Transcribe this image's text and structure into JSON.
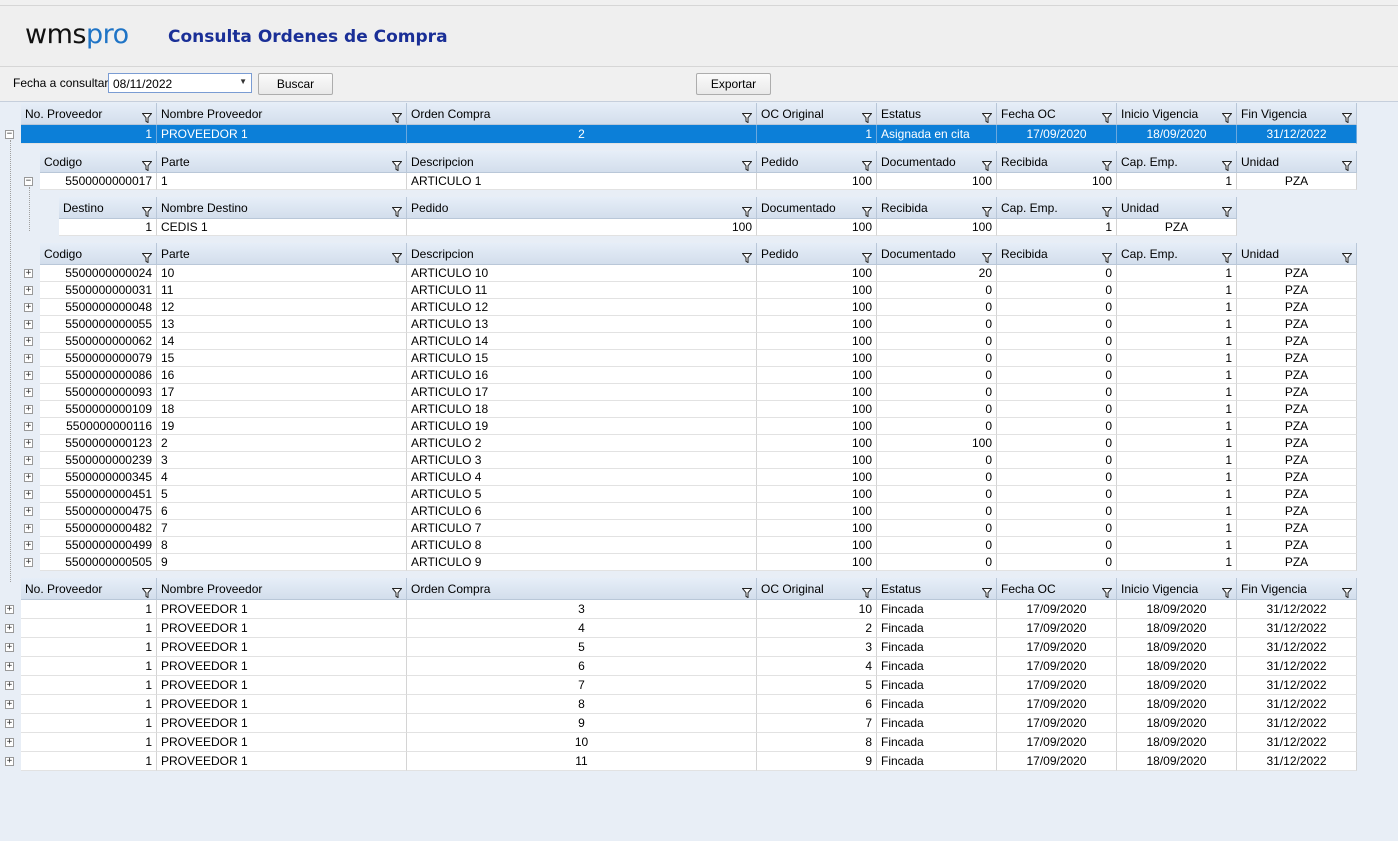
{
  "app": {
    "logo_wms": "wms",
    "logo_pro": "pro",
    "title": "Consulta Ordenes de Compra"
  },
  "toolbar": {
    "fecha_label": "Fecha a consultar",
    "fecha_value": "08/11/2022",
    "buscar": "Buscar",
    "exportar": "Exportar"
  },
  "oc_headers": [
    "No. Proveedor",
    "Nombre Proveedor",
    "Orden Compra",
    "OC Original",
    "Estatus",
    "Fecha OC",
    "Inicio Vigencia",
    "Fin Vigencia"
  ],
  "selected_order": [
    "1",
    "PROVEEDOR 1",
    "2",
    "1",
    "Asignada en cita",
    "17/09/2020",
    "18/09/2020",
    "31/12/2022"
  ],
  "item_headers": [
    "Codigo",
    "Parte",
    "Descripcion",
    "Pedido",
    "Documentado",
    "Recibida",
    "Cap. Emp.",
    "Unidad"
  ],
  "expanded_item": [
    "5500000000017",
    "1",
    "ARTICULO 1",
    "100",
    "100",
    "100",
    "1",
    "PZA"
  ],
  "dest_headers": [
    "Destino",
    "Nombre Destino",
    "Pedido",
    "Documentado",
    "Recibida",
    "Cap. Emp.",
    "Unidad"
  ],
  "dest_row": [
    "1",
    "CEDIS 1",
    "100",
    "100",
    "100",
    "1",
    "PZA"
  ],
  "items": [
    [
      "5500000000024",
      "10",
      "ARTICULO 10",
      "100",
      "20",
      "0",
      "1",
      "PZA"
    ],
    [
      "5500000000031",
      "11",
      "ARTICULO 11",
      "100",
      "0",
      "0",
      "1",
      "PZA"
    ],
    [
      "5500000000048",
      "12",
      "ARTICULO 12",
      "100",
      "0",
      "0",
      "1",
      "PZA"
    ],
    [
      "5500000000055",
      "13",
      "ARTICULO 13",
      "100",
      "0",
      "0",
      "1",
      "PZA"
    ],
    [
      "5500000000062",
      "14",
      "ARTICULO 14",
      "100",
      "0",
      "0",
      "1",
      "PZA"
    ],
    [
      "5500000000079",
      "15",
      "ARTICULO 15",
      "100",
      "0",
      "0",
      "1",
      "PZA"
    ],
    [
      "5500000000086",
      "16",
      "ARTICULO 16",
      "100",
      "0",
      "0",
      "1",
      "PZA"
    ],
    [
      "5500000000093",
      "17",
      "ARTICULO 17",
      "100",
      "0",
      "0",
      "1",
      "PZA"
    ],
    [
      "5500000000109",
      "18",
      "ARTICULO 18",
      "100",
      "0",
      "0",
      "1",
      "PZA"
    ],
    [
      "5500000000116",
      "19",
      "ARTICULO 19",
      "100",
      "0",
      "0",
      "1",
      "PZA"
    ],
    [
      "5500000000123",
      "2",
      "ARTICULO 2",
      "100",
      "100",
      "0",
      "1",
      "PZA"
    ],
    [
      "5500000000239",
      "3",
      "ARTICULO 3",
      "100",
      "0",
      "0",
      "1",
      "PZA"
    ],
    [
      "5500000000345",
      "4",
      "ARTICULO 4",
      "100",
      "0",
      "0",
      "1",
      "PZA"
    ],
    [
      "5500000000451",
      "5",
      "ARTICULO 5",
      "100",
      "0",
      "0",
      "1",
      "PZA"
    ],
    [
      "5500000000475",
      "6",
      "ARTICULO 6",
      "100",
      "0",
      "0",
      "1",
      "PZA"
    ],
    [
      "5500000000482",
      "7",
      "ARTICULO 7",
      "100",
      "0",
      "0",
      "1",
      "PZA"
    ],
    [
      "5500000000499",
      "8",
      "ARTICULO 8",
      "100",
      "0",
      "0",
      "1",
      "PZA"
    ],
    [
      "5500000000505",
      "9",
      "ARTICULO 9",
      "100",
      "0",
      "0",
      "1",
      "PZA"
    ]
  ],
  "orders": [
    [
      "1",
      "PROVEEDOR 1",
      "3",
      "10",
      "Fincada",
      "17/09/2020",
      "18/09/2020",
      "31/12/2022"
    ],
    [
      "1",
      "PROVEEDOR 1",
      "4",
      "2",
      "Fincada",
      "17/09/2020",
      "18/09/2020",
      "31/12/2022"
    ],
    [
      "1",
      "PROVEEDOR 1",
      "5",
      "3",
      "Fincada",
      "17/09/2020",
      "18/09/2020",
      "31/12/2022"
    ],
    [
      "1",
      "PROVEEDOR 1",
      "6",
      "4",
      "Fincada",
      "17/09/2020",
      "18/09/2020",
      "31/12/2022"
    ],
    [
      "1",
      "PROVEEDOR 1",
      "7",
      "5",
      "Fincada",
      "17/09/2020",
      "18/09/2020",
      "31/12/2022"
    ],
    [
      "1",
      "PROVEEDOR 1",
      "8",
      "6",
      "Fincada",
      "17/09/2020",
      "18/09/2020",
      "31/12/2022"
    ],
    [
      "1",
      "PROVEEDOR 1",
      "9",
      "7",
      "Fincada",
      "17/09/2020",
      "18/09/2020",
      "31/12/2022"
    ],
    [
      "1",
      "PROVEEDOR 1",
      "10",
      "8",
      "Fincada",
      "17/09/2020",
      "18/09/2020",
      "31/12/2022"
    ],
    [
      "1",
      "PROVEEDOR 1",
      "11",
      "9",
      "Fincada",
      "17/09/2020",
      "18/09/2020",
      "31/12/2022"
    ]
  ]
}
